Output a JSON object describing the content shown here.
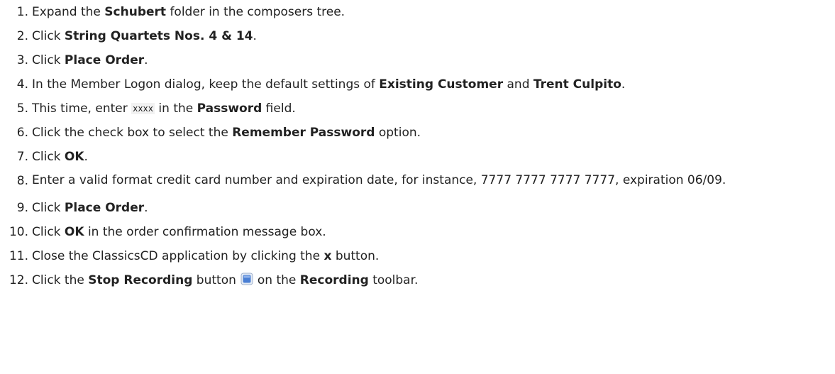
{
  "steps": [
    {
      "num": "1.",
      "parts": [
        {
          "t": "Expand the "
        },
        {
          "t": "Schubert",
          "b": true
        },
        {
          "t": " folder in the composers tree."
        }
      ]
    },
    {
      "num": "2.",
      "parts": [
        {
          "t": "Click "
        },
        {
          "t": "String Quartets Nos. 4 & 14",
          "b": true
        },
        {
          "t": "."
        }
      ]
    },
    {
      "num": "3.",
      "parts": [
        {
          "t": "Click "
        },
        {
          "t": "Place Order",
          "b": true
        },
        {
          "t": "."
        }
      ]
    },
    {
      "num": "4.",
      "parts": [
        {
          "t": "In the Member Logon dialog, keep the default settings of "
        },
        {
          "t": "Existing Customer",
          "b": true
        },
        {
          "t": " and "
        },
        {
          "t": "Trent Culpito",
          "b": true
        },
        {
          "t": "."
        }
      ]
    },
    {
      "num": "5.",
      "parts": [
        {
          "t": "This time, enter "
        },
        {
          "t": "xxxx",
          "code": true
        },
        {
          "t": " in the "
        },
        {
          "t": "Password",
          "b": true
        },
        {
          "t": " field."
        }
      ]
    },
    {
      "num": "6.",
      "parts": [
        {
          "t": "Click the check box to select the "
        },
        {
          "t": "Remember Password",
          "b": true
        },
        {
          "t": " option."
        }
      ]
    },
    {
      "num": "7.",
      "parts": [
        {
          "t": "Click "
        },
        {
          "t": "OK",
          "b": true
        },
        {
          "t": "."
        }
      ]
    },
    {
      "num": "8.",
      "wrap": true,
      "parts": [
        {
          "t": "Enter a valid format credit card number and expiration date, for instance, 7777 7777 7777 7777, expiration 06/09."
        }
      ]
    },
    {
      "num": "9.",
      "parts": [
        {
          "t": "Click "
        },
        {
          "t": "Place Order",
          "b": true
        },
        {
          "t": "."
        }
      ]
    },
    {
      "num": "10.",
      "parts": [
        {
          "t": "Click "
        },
        {
          "t": "OK",
          "b": true
        },
        {
          "t": " in the order confirmation message box."
        }
      ]
    },
    {
      "num": "11.",
      "parts": [
        {
          "t": "Close the ClassicsCD application by clicking the "
        },
        {
          "t": "x",
          "b": true
        },
        {
          "t": " button."
        }
      ]
    },
    {
      "num": "12.",
      "parts": [
        {
          "t": "Click the "
        },
        {
          "t": "Stop Recording",
          "b": true
        },
        {
          "t": " button"
        },
        {
          "icon": "stop-recording-icon"
        },
        {
          "t": "on the "
        },
        {
          "t": "Recording",
          "b": true
        },
        {
          "t": " toolbar."
        }
      ]
    }
  ],
  "colors": {
    "text": "#222222",
    "code_bg": "#f2f2f2",
    "icon_blue": "#4a7fd4"
  }
}
